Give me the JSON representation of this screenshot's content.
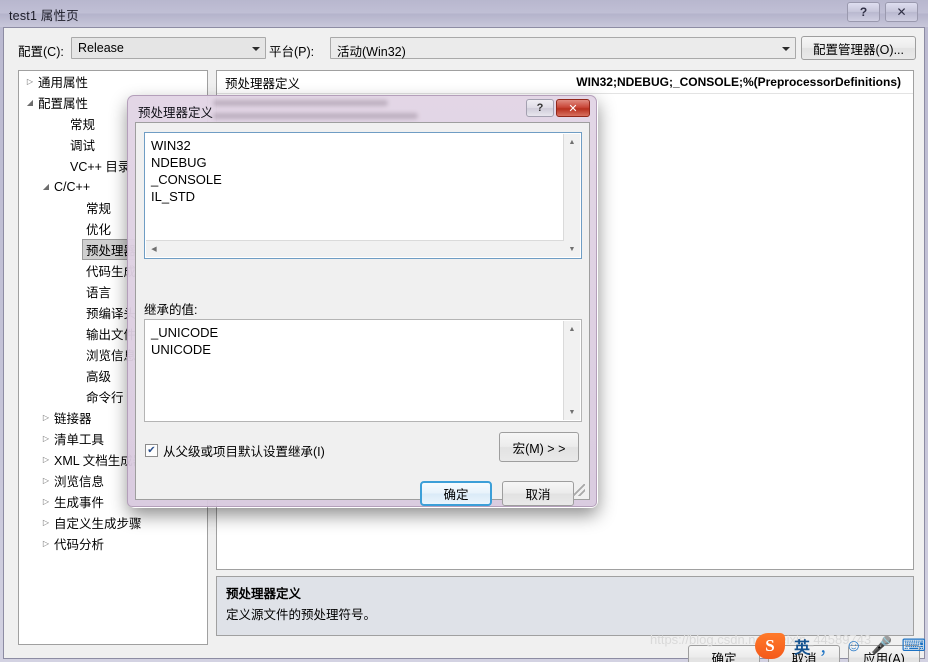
{
  "window": {
    "title": "test1 属性页",
    "help_glyph": "?",
    "close_glyph": "✕"
  },
  "config_bar": {
    "config_label": "配置(C):",
    "config_value": "Release",
    "platform_label": "平台(P):",
    "platform_value": "活动(Win32)",
    "config_manager_button": "配置管理器(O)..."
  },
  "tree": {
    "items": [
      {
        "label": "通用属性",
        "indent": 0,
        "twisty": "▷",
        "selected": false
      },
      {
        "label": "配置属性",
        "indent": 0,
        "twisty": "◢",
        "selected": false
      },
      {
        "label": "常规",
        "indent": 2,
        "twisty": "",
        "selected": false
      },
      {
        "label": "调试",
        "indent": 2,
        "twisty": "",
        "selected": false
      },
      {
        "label": "VC++ 目录",
        "indent": 2,
        "twisty": "",
        "selected": false
      },
      {
        "label": "C/C++",
        "indent": 1,
        "twisty": "◢",
        "selected": false
      },
      {
        "label": "常规",
        "indent": 3,
        "twisty": "",
        "selected": false
      },
      {
        "label": "优化",
        "indent": 3,
        "twisty": "",
        "selected": false
      },
      {
        "label": "预处理器",
        "indent": 3,
        "twisty": "",
        "selected": true
      },
      {
        "label": "代码生成",
        "indent": 3,
        "twisty": "",
        "selected": false
      },
      {
        "label": "语言",
        "indent": 3,
        "twisty": "",
        "selected": false
      },
      {
        "label": "预编译头",
        "indent": 3,
        "twisty": "",
        "selected": false
      },
      {
        "label": "输出文件",
        "indent": 3,
        "twisty": "",
        "selected": false
      },
      {
        "label": "浏览信息",
        "indent": 3,
        "twisty": "",
        "selected": false
      },
      {
        "label": "高级",
        "indent": 3,
        "twisty": "",
        "selected": false
      },
      {
        "label": "命令行",
        "indent": 3,
        "twisty": "",
        "selected": false
      },
      {
        "label": "链接器",
        "indent": 1,
        "twisty": "▷",
        "selected": false
      },
      {
        "label": "清单工具",
        "indent": 1,
        "twisty": "▷",
        "selected": false
      },
      {
        "label": "XML 文档生成器",
        "indent": 1,
        "twisty": "▷",
        "selected": false
      },
      {
        "label": "浏览信息",
        "indent": 1,
        "twisty": "▷",
        "selected": false
      },
      {
        "label": "生成事件",
        "indent": 1,
        "twisty": "▷",
        "selected": false
      },
      {
        "label": "自定义生成步骤",
        "indent": 1,
        "twisty": "▷",
        "selected": false
      },
      {
        "label": "代码分析",
        "indent": 1,
        "twisty": "▷",
        "selected": false
      }
    ]
  },
  "property_grid": {
    "rows": [
      {
        "name": "预处理器定义",
        "value": "WIN32;NDEBUG;_CONSOLE;%(PreprocessorDefinitions)"
      }
    ]
  },
  "description": {
    "title": "预处理器定义",
    "text": "定义源文件的预处理符号。"
  },
  "footer": {
    "ok": "确定",
    "cancel": "取消",
    "apply": "应用(A)"
  },
  "dialog": {
    "title": "预处理器定义",
    "help_glyph": "?",
    "close_glyph": "✕",
    "defines": "WIN32\nNDEBUG\n_CONSOLE\nIL_STD",
    "inherited_label": "继承的值:",
    "inherited": "_UNICODE\nUNICODE",
    "inherit_checkbox_label": "从父级或项目默认设置继承(I)",
    "inherit_checked": true,
    "check_glyph": "✔",
    "macro_button": "宏(M)  > >",
    "ok": "确定",
    "cancel": "取消",
    "scroll_up_glyph": "▲",
    "scroll_down_glyph": "▼",
    "scroll_left_glyph": "◀"
  },
  "overlay": {
    "watermark": "https://blog.csdn.net/weixin_44589743",
    "ime": {
      "logo": "S",
      "mode": "英",
      "punct": "，",
      "emoji": "☺",
      "mic": "🎤",
      "keyboard": "⌨"
    }
  },
  "colors": {
    "glass": "#bab9d0",
    "dialog_glass": "#e2d5e5",
    "close_red": "#c9483a",
    "focus_blue": "#3c9fd8",
    "desc_panel": "#dfe2e8"
  }
}
